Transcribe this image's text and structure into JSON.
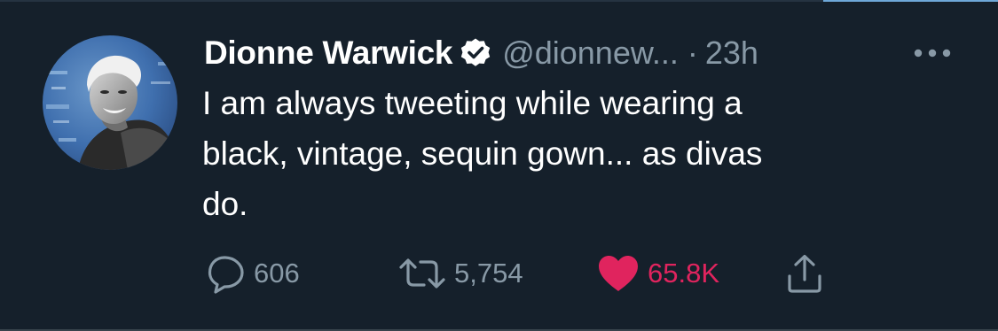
{
  "tweet": {
    "author": {
      "display_name": "Dionne Warwick",
      "handle": "@dionnew...",
      "verified": true,
      "avatar_icon": "profile-photo"
    },
    "separator": "·",
    "timestamp": "23h",
    "more_icon": "ellipsis-icon",
    "text_lines": [
      "I am always tweeting while wearing a",
      "black, vintage, sequin gown... as divas",
      "do."
    ],
    "actions": {
      "reply": {
        "icon": "reply-icon",
        "count": "606"
      },
      "retweet": {
        "icon": "retweet-icon",
        "count": "5,754"
      },
      "like": {
        "icon": "heart-icon",
        "count": "65.8K",
        "liked": true
      },
      "share": {
        "icon": "share-icon"
      }
    }
  },
  "colors": {
    "background": "#15202b",
    "primary_text": "#ffffff",
    "secondary_text": "#8899a6",
    "like_active": "#e0245e",
    "divider": "#38444d"
  }
}
